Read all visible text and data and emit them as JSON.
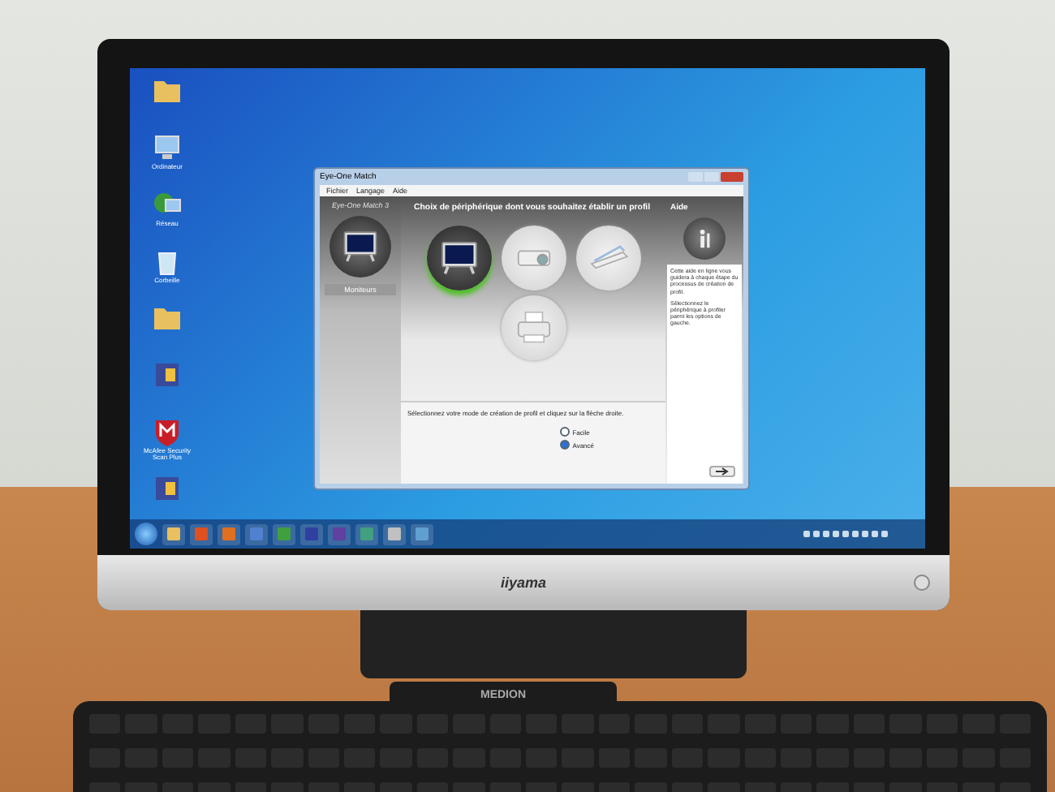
{
  "desktop": {
    "icons": [
      {
        "kind": "folder"
      },
      {
        "kind": "computer",
        "label": "Ordinateur"
      },
      {
        "kind": "network",
        "label": "Réseau"
      },
      {
        "kind": "bin",
        "label": "Corbeille"
      },
      {
        "kind": "folder"
      },
      {
        "kind": "app"
      },
      {
        "kind": "shield",
        "label": "McAfee Security Scan Plus"
      },
      {
        "kind": "app"
      }
    ]
  },
  "window": {
    "title": "Eye-One Match",
    "menu": [
      "Fichier",
      "Langage",
      "Aide"
    ],
    "logo": "Eye-One Match 3",
    "device_label": "Moniteurs",
    "heading": "Choix de périphérique dont vous souhaitez établir un profil",
    "devices": [
      {
        "kind": "monitor",
        "selected": true
      },
      {
        "kind": "projector",
        "selected": false
      },
      {
        "kind": "scanner",
        "selected": false
      },
      {
        "kind": "printer",
        "selected": false
      }
    ],
    "instruction": "Sélectionnez votre mode de création de profil et cliquez sur la flèche droite.",
    "modes": [
      {
        "label": "Facile",
        "selected": false
      },
      {
        "label": "Avancé",
        "selected": true
      }
    ],
    "help": {
      "title": "Aide",
      "paragraphs": [
        "Cette aide en ligne vous guidera à chaque étape du processus de création de profil.",
        "Sélectionnez le périphérique à profiler parmi les options de gauche."
      ]
    }
  },
  "monitor": {
    "brand": "iiyama"
  },
  "keyboard": {
    "brand": "MEDION"
  }
}
